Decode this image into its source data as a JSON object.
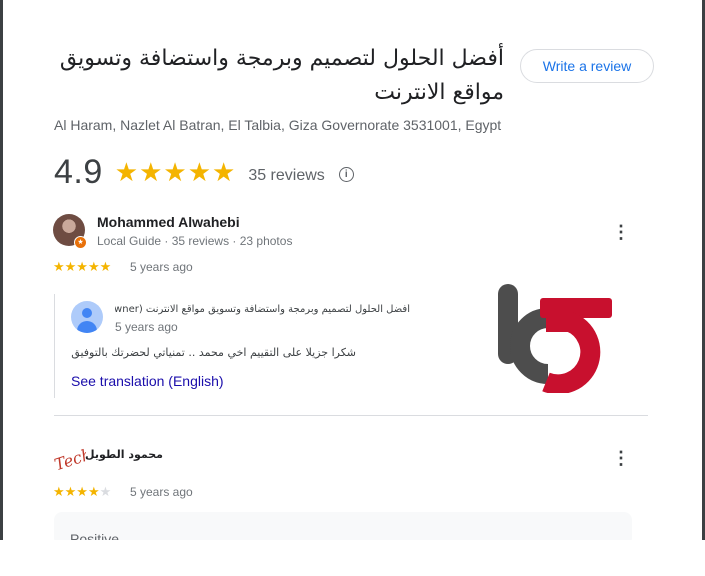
{
  "business": {
    "name": "أفضل الحلول لتصميم وبرمجة واستضافة وتسويق مواقع الانترنت",
    "address": "Al Haram, Nazlet Al Batran, El Talbia, Giza Governorate 3531001, Egypt",
    "write_review_label": "Write a review",
    "rating": "4.9",
    "stars": "★★★★★",
    "review_count": "35 reviews",
    "info_icon": "info-icon"
  },
  "reviews": [
    {
      "author": "Mohammed Alwahebi",
      "meta": "Local Guide · 35 reviews · 23 photos",
      "stars_on": "★★★★★",
      "stars_off": "",
      "rating_value": 5,
      "date": "5 years ago",
      "owner_reply": {
        "owner_line": "أفضل الحلول لتصميم وبرمجة واستضافة وتسويق مواقع الانترنت (owner)",
        "date": "5 years ago",
        "text": "شكرا جزيلا على التقييم اخي محمد .. تمنياتي لحضرتك بالتوفيق",
        "translate_label": "See translation (English)"
      }
    },
    {
      "author": "محمود الطويل",
      "stars_on": "★★★★",
      "stars_off": "★",
      "rating_value": 4,
      "date": "5 years ago",
      "positive_label": "Positive"
    }
  ],
  "colors": {
    "star": "#f4b400",
    "link": "#1a73e8",
    "logo_gray": "#4d4d4d",
    "logo_red": "#c8102e"
  },
  "logo_text": "b5"
}
